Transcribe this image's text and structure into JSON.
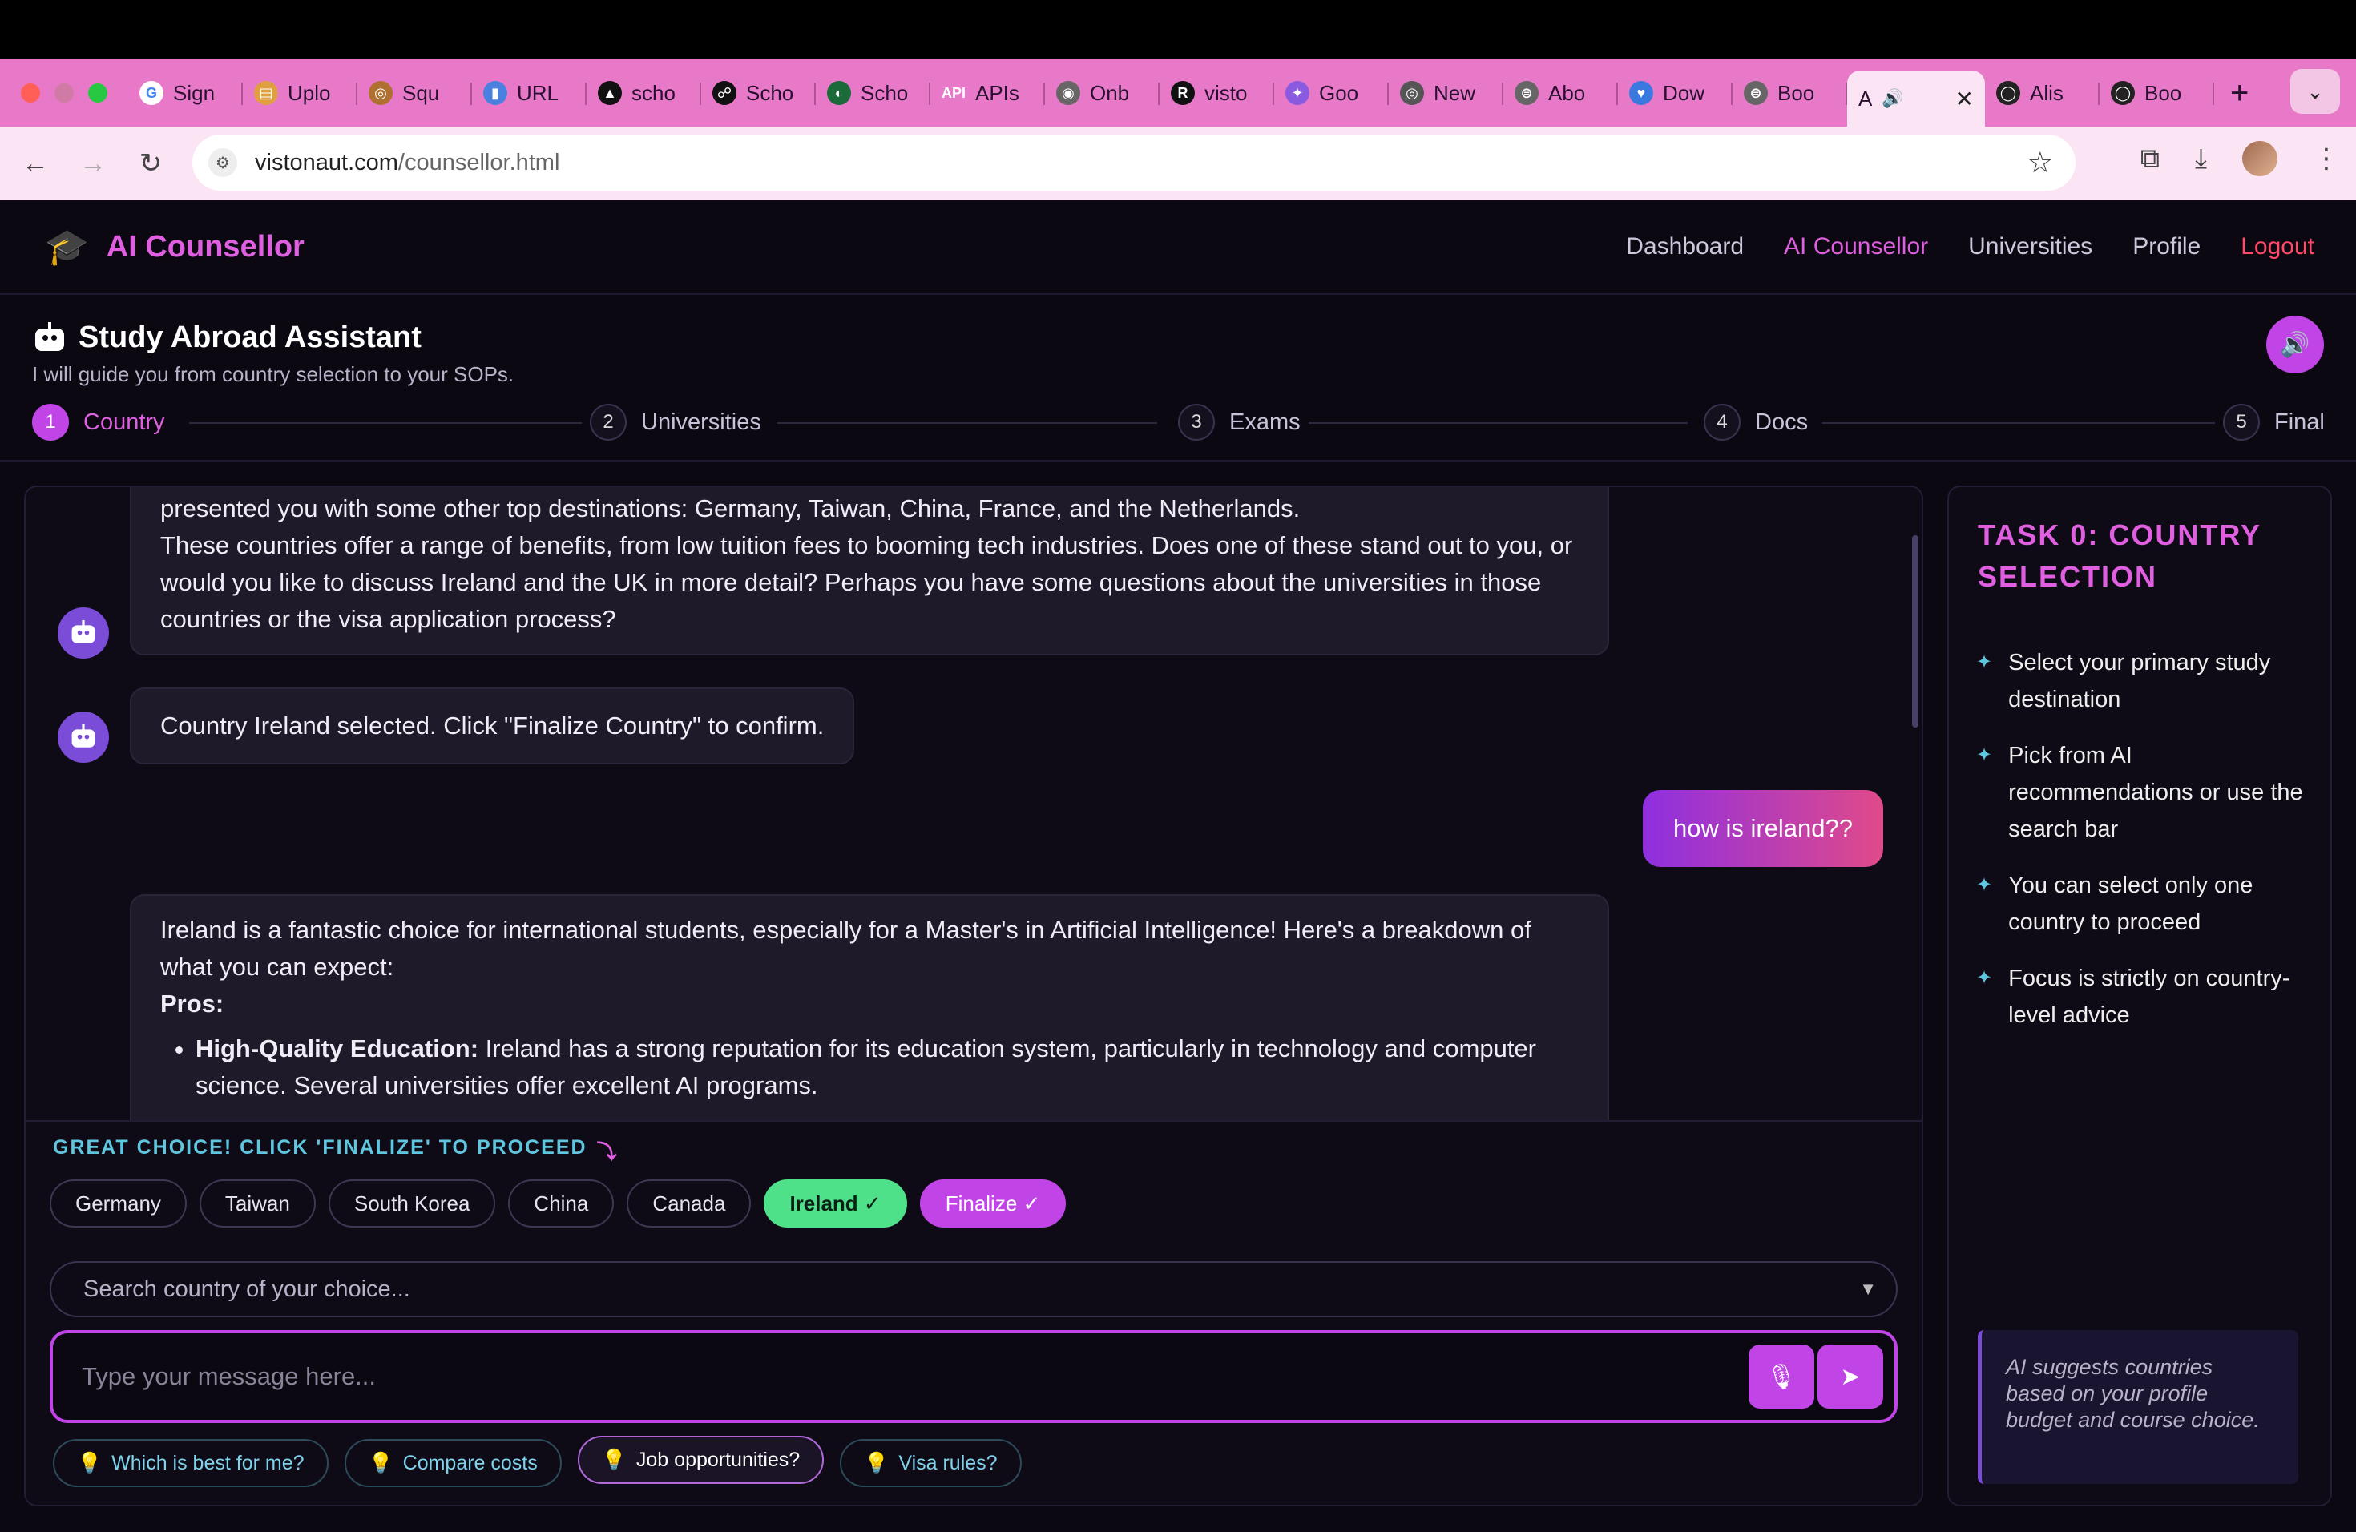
{
  "browser": {
    "tabs": [
      {
        "label": "Sign",
        "color": "#ffffff",
        "glyph": "G"
      },
      {
        "label": "Uplo",
        "color": "#e0a040",
        "glyph": "▤"
      },
      {
        "label": "Squ",
        "color": "#b07030",
        "glyph": "◎"
      },
      {
        "label": "URL",
        "color": "#4a80e0",
        "glyph": "▮"
      },
      {
        "label": "scho",
        "color": "#111111",
        "glyph": "▲"
      },
      {
        "label": "Scho",
        "color": "#111111",
        "glyph": "☍"
      },
      {
        "label": "Scho",
        "color": "#1a6a3a",
        "glyph": "◐"
      },
      {
        "label": "APIs",
        "color": "#e879c8",
        "glyph": "API"
      },
      {
        "label": "Onb",
        "color": "#666666",
        "glyph": "◉"
      },
      {
        "label": "visto",
        "color": "#111111",
        "glyph": "R"
      },
      {
        "label": "Goo",
        "color": "#8a5ae0",
        "glyph": "✦"
      },
      {
        "label": "New",
        "color": "#555555",
        "glyph": "◎"
      },
      {
        "label": "Abo",
        "color": "#666666",
        "glyph": "⊜"
      },
      {
        "label": "Dow",
        "color": "#3a7ae0",
        "glyph": "♥"
      },
      {
        "label": "Boo",
        "color": "#666666",
        "glyph": "⊜"
      }
    ],
    "active_tab_label": "A",
    "tabs_after": [
      {
        "label": "Alis",
        "color": "#222222",
        "glyph": "◯"
      },
      {
        "label": "Boo",
        "color": "#222222",
        "glyph": "◯"
      }
    ],
    "url_host": "vistonaut.com",
    "url_path": "/counsellor.html"
  },
  "app": {
    "brand": "AI Counsellor",
    "nav": [
      "Dashboard",
      "AI Counsellor",
      "Universities",
      "Profile",
      "Logout"
    ]
  },
  "assistant": {
    "title": "Study Abroad Assistant",
    "subtitle": "I will guide you from country selection to your SOPs.",
    "steps": [
      {
        "num": "1",
        "label": "Country"
      },
      {
        "num": "2",
        "label": "Universities"
      },
      {
        "num": "3",
        "label": "Exams"
      },
      {
        "num": "4",
        "label": "Docs"
      },
      {
        "num": "5",
        "label": "Final"
      }
    ]
  },
  "messages": {
    "bot1_line1": "presented you with some other top destinations: Germany, Taiwan, China, France, and the Netherlands.",
    "bot1_line2": "These countries offer a range of benefits, from low tuition fees to booming tech industries. Does one of these stand out to you, or would you like to discuss Ireland and the UK in more detail? Perhaps you have some questions about the universities in those countries or the visa application process?",
    "bot2": "Country Ireland selected. Click \"Finalize Country\" to confirm.",
    "user1": "how is ireland??",
    "bot3_intro": "Ireland is a fantastic choice for international students, especially for a Master's in Artificial Intelligence! Here's a breakdown of what you can expect:",
    "bot3_pros": "Pros:",
    "bot3_item1_bold": "High-Quality Education:",
    "bot3_item1_text": " Ireland has a strong reputation for its education system, particularly in technology and computer science. Several universities offer excellent AI programs."
  },
  "composer": {
    "hint": "GREAT CHOICE! CLICK 'FINALIZE' TO PROCEED",
    "hint_arrow": "⤵",
    "chips": [
      "Germany",
      "Taiwan",
      "South Korea",
      "China",
      "Canada"
    ],
    "selected_chip": "Ireland ✓",
    "finalize_chip": "Finalize ✓",
    "country_search_placeholder": "Search country of your choice...",
    "message_placeholder": "Type your message here...",
    "suggestions": [
      "Which is best for me?",
      "Compare costs",
      "Job opportunities?",
      "Visa rules?"
    ]
  },
  "side": {
    "title": "TASK 0: COUNTRY SELECTION",
    "tasks": [
      "Select your primary study destination",
      "Pick from AI recommendations or use the search bar",
      "You can select only one country to proceed",
      "Focus is strictly on country-level advice"
    ],
    "note": "AI suggests countries based on your profile budget and course choice."
  },
  "colors": {
    "accent": "#c044e6",
    "brand": "#e05ee0",
    "success": "#4fe08a",
    "info": "#5fc6e0",
    "danger": "#ff4a6a"
  }
}
